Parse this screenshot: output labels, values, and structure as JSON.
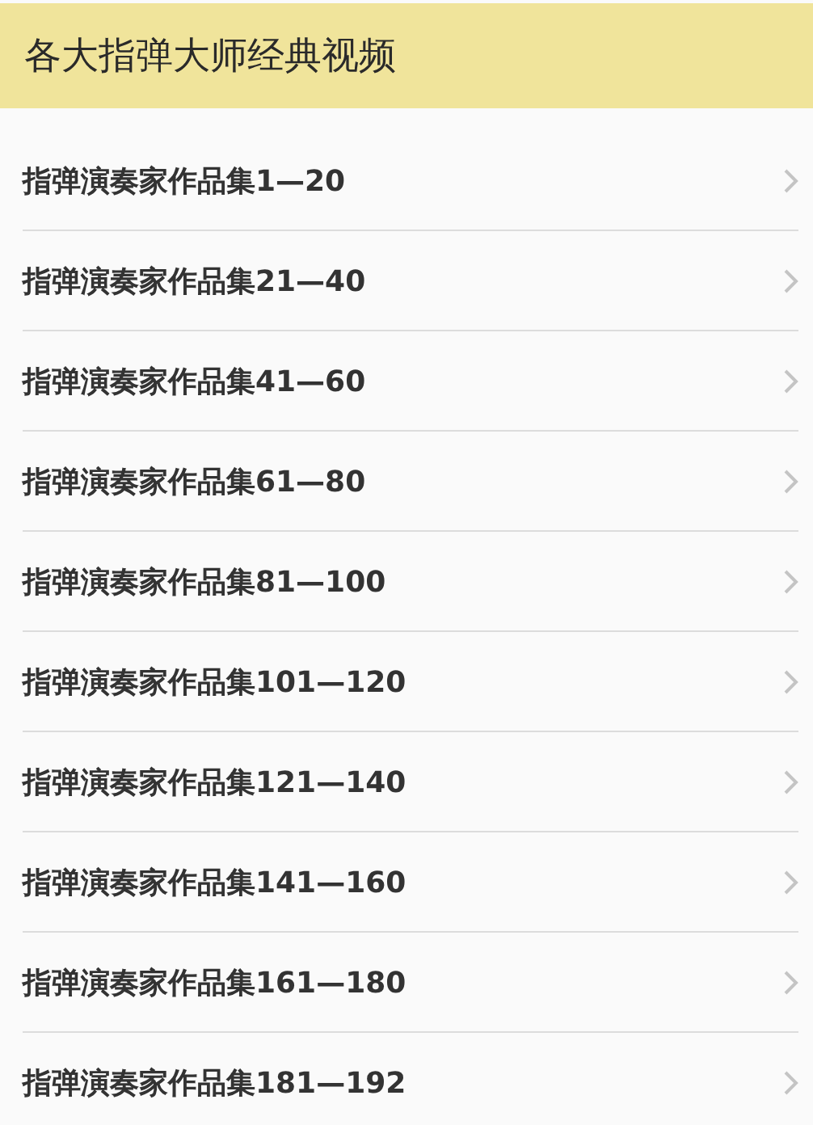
{
  "header": {
    "title": "各大指弹大师经典视频"
  },
  "items": [
    {
      "label": "指弹演奏家作品集1—20"
    },
    {
      "label": "指弹演奏家作品集21—40"
    },
    {
      "label": "指弹演奏家作品集41—60"
    },
    {
      "label": "指弹演奏家作品集61—80"
    },
    {
      "label": "指弹演奏家作品集81—100"
    },
    {
      "label": "指弹演奏家作品集101—120"
    },
    {
      "label": "指弹演奏家作品集121—140"
    },
    {
      "label": "指弹演奏家作品集141—160"
    },
    {
      "label": "指弹演奏家作品集161—180"
    },
    {
      "label": "指弹演奏家作品集181—192"
    }
  ]
}
